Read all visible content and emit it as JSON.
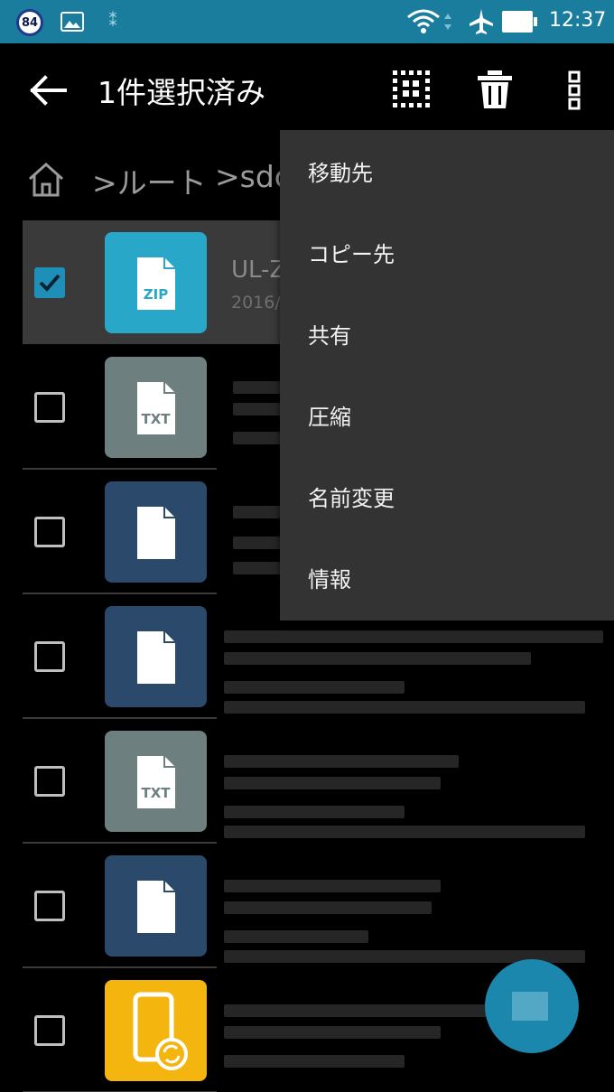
{
  "status_bar": {
    "badge": "84",
    "time": "12:37",
    "icons": [
      "notification-badge-icon",
      "photo-icon",
      "usb-icon",
      "wifi-icon",
      "airplane-mode-icon",
      "battery-icon"
    ]
  },
  "app_bar": {
    "title": "1件選択済み",
    "icons": [
      "back-arrow-icon",
      "select-all-icon",
      "trash-icon",
      "more-vert-icon"
    ]
  },
  "breadcrumb": {
    "items": [
      "ルート",
      "sdc"
    ]
  },
  "files": [
    {
      "type_label": "ZIP",
      "name": "UL-Z",
      "date": "2016/",
      "checked": true,
      "icon_color": "#29a7c8"
    },
    {
      "type_label": "TXT",
      "checked": false,
      "icon_color": "#6d7f7f"
    },
    {
      "type_label": "",
      "checked": false,
      "icon_color": "#2b4a6b"
    },
    {
      "type_label": "",
      "checked": false,
      "icon_color": "#2b4a6b"
    },
    {
      "type_label": "TXT",
      "checked": false,
      "icon_color": "#6d7f7f"
    },
    {
      "type_label": "",
      "checked": false,
      "icon_color": "#2b4a6b"
    },
    {
      "type_label": "",
      "checked": false,
      "icon_color": "#f5b50f"
    }
  ],
  "menu": {
    "items": [
      "移動先",
      "コピー先",
      "共有",
      "圧縮",
      "名前変更",
      "情報"
    ]
  },
  "colors": {
    "status_bar": "#1a7d9e",
    "selected_row": "#3a3a3a",
    "menu_bg": "#333333",
    "checkbox_accent": "#1f8fb8",
    "fab": "#1b87ad"
  }
}
